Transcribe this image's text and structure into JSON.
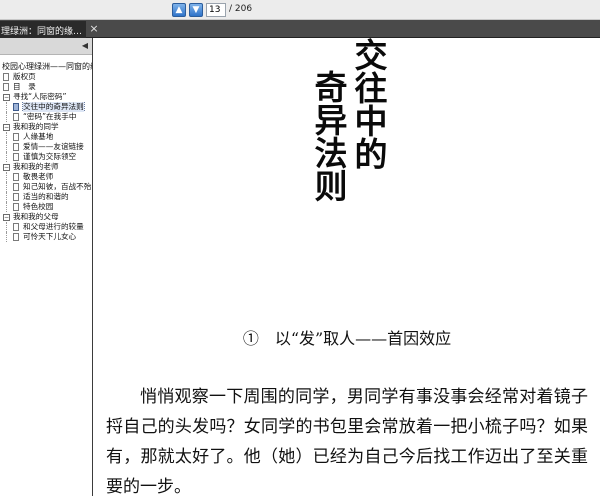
{
  "toolbar": {
    "up_icon": "arrow-up-icon",
    "down_icon": "arrow-down-icon",
    "current_page": "13",
    "total_pages": "/ 206"
  },
  "tab": {
    "title": "理绿洲：同窗的缘…",
    "close": "×"
  },
  "sidebar": {
    "root": "校园心理绿洲——同窗的缘",
    "items": [
      {
        "label": "版权页",
        "level": 0,
        "kind": "page"
      },
      {
        "label": "目　录",
        "level": 0,
        "kind": "page"
      },
      {
        "label": "寻找“人际密码”",
        "level": 0,
        "kind": "toggle"
      },
      {
        "label": "交往中的奇异法则",
        "level": 1,
        "kind": "page",
        "selected": true
      },
      {
        "label": "“密码”在我手中",
        "level": 1,
        "kind": "page"
      },
      {
        "label": "我和我的同学",
        "level": 0,
        "kind": "toggle"
      },
      {
        "label": "人缘基地",
        "level": 1,
        "kind": "page"
      },
      {
        "label": "爱情——友谊链接",
        "level": 1,
        "kind": "page"
      },
      {
        "label": "谨慎为交际领空",
        "level": 1,
        "kind": "page"
      },
      {
        "label": "我和我的老师",
        "level": 0,
        "kind": "toggle"
      },
      {
        "label": "敬畏老师",
        "level": 1,
        "kind": "page"
      },
      {
        "label": "知己知彼，百战不殆",
        "level": 1,
        "kind": "page"
      },
      {
        "label": "适当的和谐的",
        "level": 1,
        "kind": "page"
      },
      {
        "label": "特色校园",
        "level": 1,
        "kind": "page"
      },
      {
        "label": "我和我的父母",
        "level": 0,
        "kind": "toggle"
      },
      {
        "label": "和父母进行的较量",
        "level": 1,
        "kind": "page"
      },
      {
        "label": "可怜天下儿女心",
        "level": 1,
        "kind": "page"
      }
    ]
  },
  "page": {
    "title_col1": "交往中的",
    "title_col2": "奇异法则",
    "section_heading": "①　以“发”取人——首因效应",
    "body": "悄悄观察一下周围的同学，男同学有事没事会经常对着镜子捋自己的头发吗？女同学的书包里会常放着一把小梳子吗？如果有，那就太好了。他（她）已经为自己今后找工作迈出了至关重要的一步。"
  }
}
